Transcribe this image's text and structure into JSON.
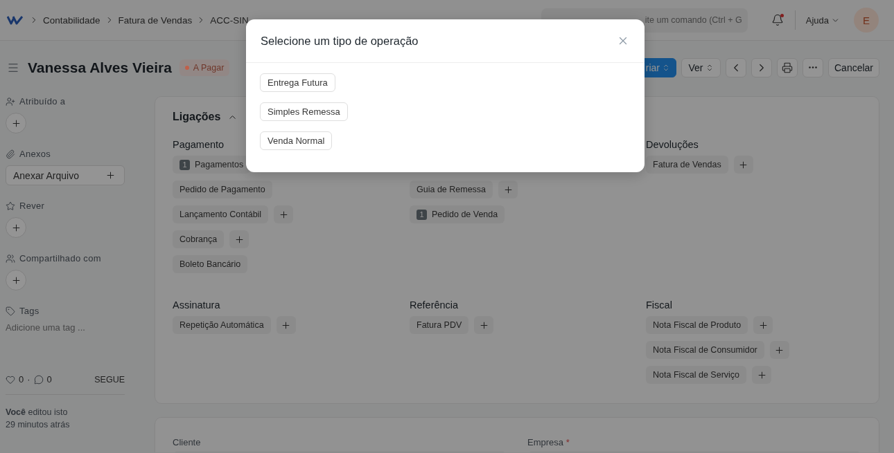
{
  "navbar": {
    "breadcrumbs": [
      "Contabilidade",
      "Fatura de Vendas",
      "ACC-SIN"
    ],
    "search": {
      "placeholder": "ite um comando (Ctrl + G"
    },
    "notifications_unread": true,
    "help": "Ajuda",
    "avatar": "E"
  },
  "header": {
    "title": "Vanessa Alves Vieira",
    "status": {
      "label": "A Pagar",
      "color": "#c0604a"
    },
    "buttons": [
      {
        "kind": "primary-select",
        "label": "riar"
      },
      {
        "kind": "select",
        "label": "Ver"
      },
      {
        "kind": "prev"
      },
      {
        "kind": "next"
      },
      {
        "kind": "print"
      },
      {
        "kind": "more"
      },
      {
        "kind": "plain",
        "label": "Cancelar"
      }
    ]
  },
  "sidebar": {
    "sections": [
      {
        "kind": "assign",
        "label": "Atribuído a"
      },
      {
        "kind": "attach",
        "label": "Anexos",
        "button": "Anexar Arquivo"
      },
      {
        "kind": "review",
        "label": "Rever"
      },
      {
        "kind": "share",
        "label": "Compartilhado com"
      },
      {
        "kind": "tags",
        "label": "Tags",
        "placeholder": "Adicione uma tag ..."
      }
    ],
    "likes": "0",
    "separator": "·",
    "comments": "0",
    "follow": "SEGUE",
    "activity": "**Você** editou isto",
    "time": "29 minutos atrás"
  },
  "connections": {
    "title": "Ligações",
    "expanded": true,
    "groups": [
      {
        "heading": "Pagamento",
        "items": [
          {
            "label": "Pagamentos",
            "count": "1",
            "addable": false
          },
          {
            "label": "Pedido de Pagamento",
            "addable": false
          },
          {
            "label": "Lançamento Contábil",
            "addable": true
          },
          {
            "label": "Cobrança",
            "addable": true
          },
          {
            "label": "Boleto Bancário",
            "addable": false
          }
        ]
      },
      {
        "items": [
          {
            "label": "Guia de Remessa",
            "addable": true
          },
          {
            "label": "Pedido de Venda",
            "count": "1",
            "addable": false
          }
        ]
      },
      {
        "heading": "Devoluções",
        "items": [
          {
            "label": "Fatura de Vendas",
            "addable": true
          }
        ]
      },
      {
        "heading": "Assinatura",
        "items": [
          {
            "label": "Repetição Automática",
            "addable": true
          }
        ]
      },
      {
        "heading": "Referência",
        "items": [
          {
            "label": "Fatura PDV",
            "addable": true
          }
        ]
      },
      {
        "heading": "Fiscal",
        "items": [
          {
            "label": "Nota Fiscal de Produto",
            "addable": true
          },
          {
            "label": "Nota Fiscal de Consumidor",
            "addable": true
          },
          {
            "label": "Nota Fiscal de Serviço",
            "addable": true
          }
        ]
      }
    ]
  },
  "form": {
    "fields": [
      {
        "label": "Cliente"
      },
      {
        "label": "Empresa",
        "required_mark": "*"
      }
    ]
  },
  "dialog": {
    "title": "Selecione um tipo de operação",
    "options": [
      "Entrega Futura",
      "Simples Remessa",
      "Venda Normal"
    ]
  }
}
